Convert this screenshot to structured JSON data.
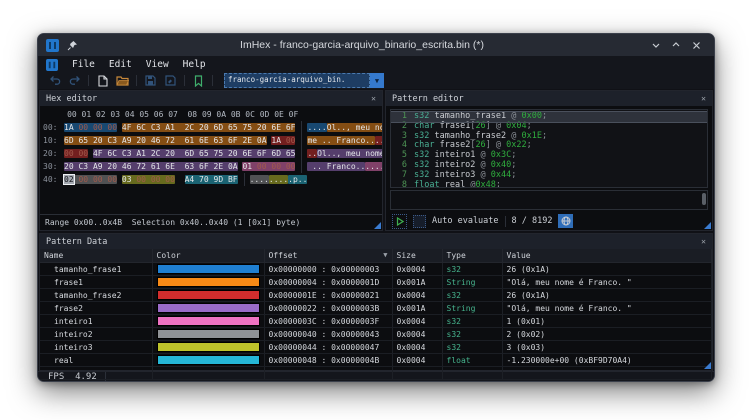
{
  "window": {
    "title": "ImHex - franco-garcia-arquivo_binario_escrita.bin (*)"
  },
  "menu": {
    "items": [
      "File",
      "Edit",
      "View",
      "Help"
    ]
  },
  "toolbar": {
    "file_name": "franco-garcia-arquivo_bin.",
    "dropdown_arrow": "▼"
  },
  "hex_editor": {
    "title": "Hex editor",
    "close_label": "✕",
    "col_header": "     00 01 02 03 04 05 06 07  08 09 0A 0B 0C 0D 0E 0F",
    "palette": {
      "blue": "#1f7fd1",
      "orange": "#f88a16",
      "red": "#d32d2d",
      "purple": "#9a6bc8",
      "pink": "#ef72c2",
      "gray": "#8f9296",
      "olive": "#bec32b",
      "teal": "#25b6d6"
    },
    "rows": [
      {
        "addr": "00:",
        "groups": [
          {
            "c": "blue",
            "b": [
              "1A",
              "00",
              "00",
              "00"
            ]
          },
          {
            "c": "orange",
            "b": [
              "4F",
              "6C",
              "C3",
              "A1",
              "2C",
              "20",
              "6D",
              "65",
              "75",
              "20",
              "6E",
              "6F"
            ]
          }
        ],
        "ascii": [
          {
            "c": "blue",
            "t": "...."
          },
          {
            "c": "orange",
            "t": "Ol.., meu no"
          }
        ]
      },
      {
        "addr": "10:",
        "groups": [
          {
            "c": "orange",
            "b": [
              "6D",
              "65",
              "20",
              "C3",
              "A9",
              "20",
              "46",
              "72",
              "61",
              "6E",
              "63",
              "6F",
              "2E",
              "0A"
            ]
          },
          {
            "c": "red",
            "b": [
              "1A",
              "00"
            ]
          }
        ],
        "ascii": [
          {
            "c": "orange",
            "t": "me .. Franco.."
          },
          {
            "c": "red",
            "t": ".."
          }
        ]
      },
      {
        "addr": "20:",
        "groups": [
          {
            "c": "red",
            "b": [
              "00",
              "00"
            ]
          },
          {
            "c": "purple",
            "b": [
              "4F",
              "6C",
              "C3",
              "A1",
              "2C",
              "20",
              "6D",
              "65",
              "75",
              "20",
              "6E",
              "6F",
              "6D",
              "65"
            ]
          }
        ],
        "ascii": [
          {
            "c": "red",
            "t": ".."
          },
          {
            "c": "purple",
            "t": "Ol.., meu nome"
          }
        ]
      },
      {
        "addr": "30:",
        "groups": [
          {
            "c": "purple",
            "b": [
              "20",
              "C3",
              "A9",
              "20",
              "46",
              "72",
              "61",
              "6E",
              "63",
              "6F",
              "2E",
              "0A"
            ]
          },
          {
            "c": "pink",
            "b": [
              "01",
              "00",
              "00",
              "00"
            ]
          }
        ],
        "ascii": [
          {
            "c": "purple",
            "t": " .. Franco.."
          },
          {
            "c": "pink",
            "t": "...."
          }
        ]
      },
      {
        "addr": "40:",
        "groups": [
          {
            "c": "gray",
            "b": [
              "02",
              "00",
              "00",
              "00"
            ],
            "cursor": 0
          },
          {
            "c": "olive",
            "b": [
              "03",
              "00",
              "00",
              "00"
            ]
          },
          {
            "c": "teal",
            "b": [
              "A4",
              "70",
              "9D",
              "BF"
            ]
          }
        ],
        "ascii": [
          {
            "c": "gray",
            "t": "...."
          },
          {
            "c": "olive",
            "t": "...."
          },
          {
            "c": "teal",
            "t": ".p.."
          }
        ]
      }
    ],
    "status": "Range 0x00..0x4B  Selection 0x40..0x40 (1 [0x1] byte)"
  },
  "pattern_editor": {
    "title": "Pattern editor",
    "close_label": "✕",
    "lines": [
      {
        "num": "1",
        "active": true,
        "parts": [
          {
            "c": "kw",
            "t": "s32"
          },
          {
            "c": "id",
            "t": " tamanho_frase1 "
          },
          {
            "c": "op",
            "t": "@"
          },
          {
            "c": "num",
            "t": " 0x00"
          },
          {
            "c": "op",
            "t": ";"
          }
        ]
      },
      {
        "num": "2",
        "parts": [
          {
            "c": "kw",
            "t": "char"
          },
          {
            "c": "id",
            "t": " frase1"
          },
          {
            "c": "op",
            "t": "["
          },
          {
            "c": "num",
            "t": "26"
          },
          {
            "c": "op",
            "t": "]"
          },
          {
            "c": "op",
            "t": " @"
          },
          {
            "c": "num",
            "t": " 0x04"
          },
          {
            "c": "op",
            "t": ";"
          }
        ]
      },
      {
        "num": "3",
        "parts": [
          {
            "c": "kw",
            "t": "s32"
          },
          {
            "c": "id",
            "t": " tamanho_frase2 "
          },
          {
            "c": "op",
            "t": "@"
          },
          {
            "c": "num",
            "t": " 0x1E"
          },
          {
            "c": "op",
            "t": ";"
          }
        ]
      },
      {
        "num": "4",
        "parts": [
          {
            "c": "kw",
            "t": "char"
          },
          {
            "c": "id",
            "t": " frase2"
          },
          {
            "c": "op",
            "t": "["
          },
          {
            "c": "num",
            "t": "26"
          },
          {
            "c": "op",
            "t": "]"
          },
          {
            "c": "op",
            "t": " @"
          },
          {
            "c": "num",
            "t": " 0x22"
          },
          {
            "c": "op",
            "t": ";"
          }
        ]
      },
      {
        "num": "5",
        "parts": [
          {
            "c": "kw",
            "t": "s32"
          },
          {
            "c": "id",
            "t": " inteiro1 "
          },
          {
            "c": "op",
            "t": "@"
          },
          {
            "c": "num",
            "t": " 0x3C"
          },
          {
            "c": "op",
            "t": ";"
          }
        ]
      },
      {
        "num": "6",
        "parts": [
          {
            "c": "kw",
            "t": "s32"
          },
          {
            "c": "id",
            "t": " inteiro2 "
          },
          {
            "c": "op",
            "t": "@"
          },
          {
            "c": "num",
            "t": " 0x40"
          },
          {
            "c": "op",
            "t": ";"
          }
        ]
      },
      {
        "num": "7",
        "parts": [
          {
            "c": "kw",
            "t": "s32"
          },
          {
            "c": "id",
            "t": " inteiro3 "
          },
          {
            "c": "op",
            "t": "@"
          },
          {
            "c": "num",
            "t": " 0x44"
          },
          {
            "c": "op",
            "t": ";"
          }
        ]
      },
      {
        "num": "8",
        "parts": [
          {
            "c": "kw",
            "t": "float"
          },
          {
            "c": "id",
            "t": " real "
          },
          {
            "c": "op",
            "t": "@"
          },
          {
            "c": "num",
            "t": "0x48"
          },
          {
            "c": "op",
            "t": ";"
          }
        ]
      }
    ],
    "footer": {
      "auto_evaluate": "Auto evaluate",
      "progress": "8 / 8192"
    }
  },
  "pattern_data": {
    "title": "Pattern Data",
    "close_label": "✕",
    "columns": [
      "Name",
      "Color",
      "Offset",
      "Size",
      "Type",
      "Value"
    ],
    "sort_indicator": "▼",
    "rows": [
      {
        "name": "tamanho_frase1",
        "color": "#1f7fd1",
        "offset": "0x00000000 : 0x00000003",
        "size": "0x0004",
        "type": "s32",
        "value": "26 (0x1A)"
      },
      {
        "name": "frase1",
        "color": "#f88a16",
        "offset": "0x00000004 : 0x0000001D",
        "size": "0x001A",
        "type": "String",
        "value": "\"Olá, meu nome é Franco. \""
      },
      {
        "name": "tamanho_frase2",
        "color": "#d32d2d",
        "offset": "0x0000001E : 0x00000021",
        "size": "0x0004",
        "type": "s32",
        "value": "26 (0x1A)"
      },
      {
        "name": "frase2",
        "color": "#9a6bc8",
        "offset": "0x00000022 : 0x0000003B",
        "size": "0x001A",
        "type": "String",
        "value": "\"Olá, meu nome é Franco. \""
      },
      {
        "name": "inteiro1",
        "color": "#ef72c2",
        "offset": "0x0000003C : 0x0000003F",
        "size": "0x0004",
        "type": "s32",
        "value": "1 (0x01)"
      },
      {
        "name": "inteiro2",
        "color": "#8f9296",
        "offset": "0x00000040 : 0x00000043",
        "size": "0x0004",
        "type": "s32",
        "value": "2 (0x02)"
      },
      {
        "name": "inteiro3",
        "color": "#bec32b",
        "offset": "0x00000044 : 0x00000047",
        "size": "0x0004",
        "type": "s32",
        "value": "3 (0x03)"
      },
      {
        "name": "real",
        "color": "#25b6d6",
        "offset": "0x00000048 : 0x0000004B",
        "size": "0x0004",
        "type": "float",
        "value": "-1.230000e+00 (0xBF9D70A4)"
      }
    ]
  },
  "status_bar": {
    "fps": "FPS  4.92"
  }
}
